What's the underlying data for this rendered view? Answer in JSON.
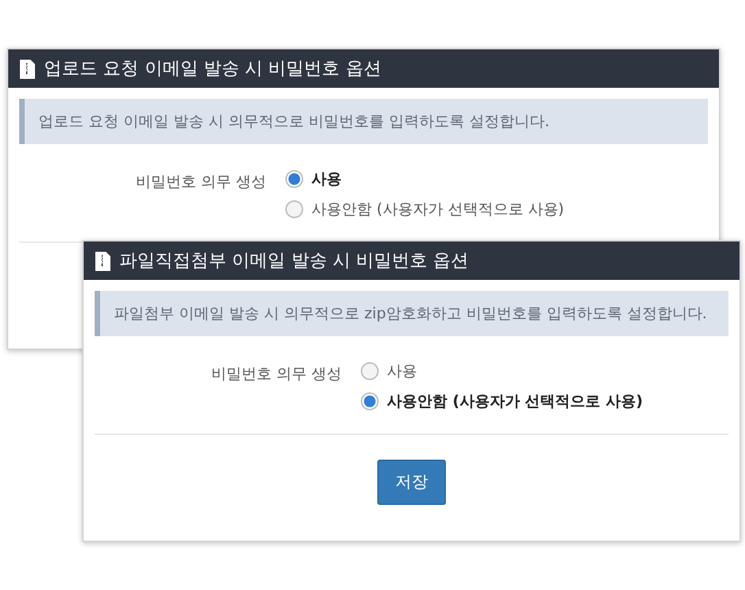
{
  "panels": [
    {
      "title": "업로드 요청 이메일 발송 시 비밀번호 옵션",
      "notice": "업로드 요청 이메일 발송 시 의무적으로 비밀번호를 입력하도록 설정합니다.",
      "field_label": "비밀번호 의무 생성",
      "options": [
        {
          "label": "사용",
          "selected": true
        },
        {
          "label": "사용안함 (사용자가 선택적으로 사용)",
          "selected": false
        }
      ]
    },
    {
      "title": "파일직접첨부 이메일 발송 시 비밀번호 옵션",
      "notice": "파일첨부 이메일 발송 시 의무적으로 zip암호화하고 비밀번호를 입력하도록 설정합니다.",
      "field_label": "비밀번호 의무 생성",
      "options": [
        {
          "label": "사용",
          "selected": false
        },
        {
          "label": "사용안함 (사용자가 선택적으로 사용)",
          "selected": true
        }
      ],
      "save_button": "저장"
    }
  ]
}
